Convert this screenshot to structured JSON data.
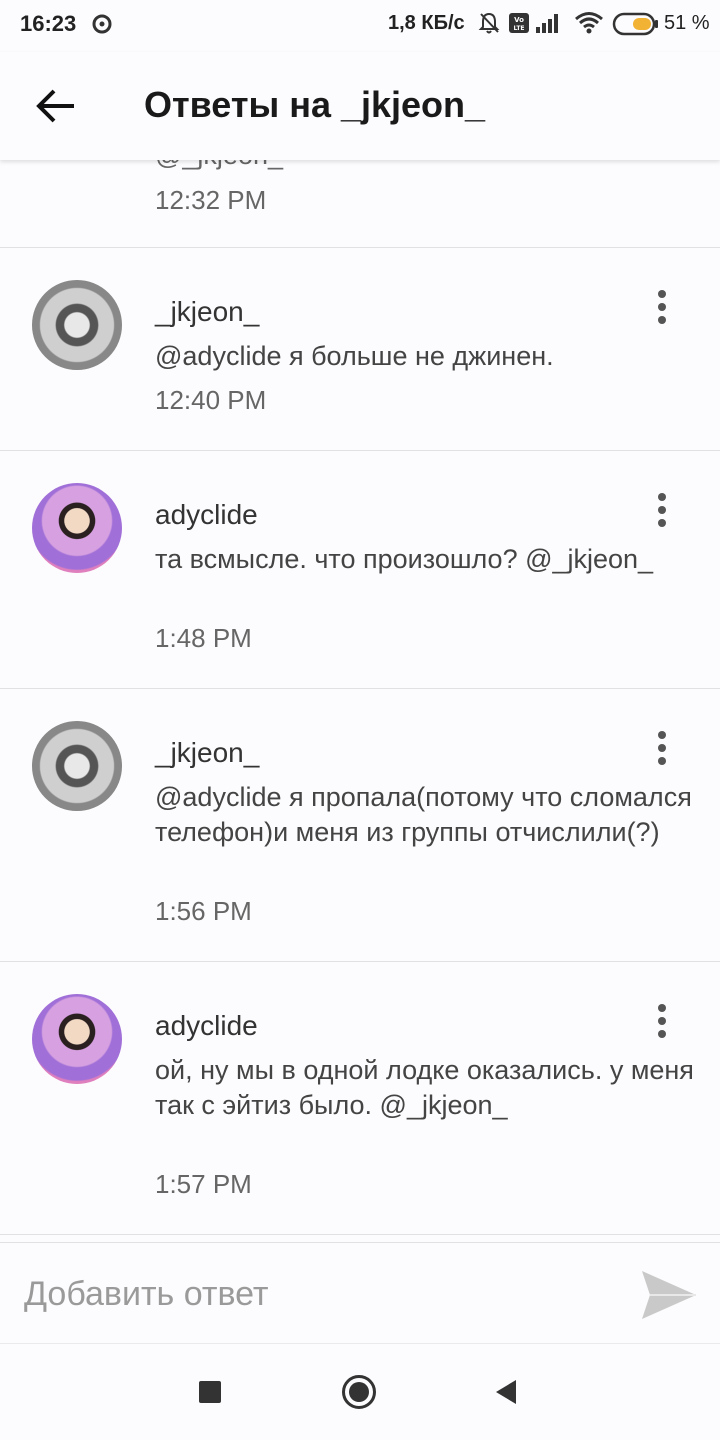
{
  "status_bar": {
    "time": "16:23",
    "network_speed": "1,8 КБ/с",
    "battery_percent": "51 %",
    "icons": [
      "sync-icon",
      "mute-icon",
      "volte-icon",
      "signal-icon",
      "wifi-icon",
      "battery-icon"
    ]
  },
  "app_bar": {
    "title": "Ответы на _jkjeon_",
    "back_icon": "arrow-left-icon"
  },
  "partial_reply": {
    "mention": "@_jkjeon_",
    "time": "12:32 PM"
  },
  "replies": [
    {
      "author": "_jkjeon_",
      "text": "@adyclide  я больше не джинен.",
      "time": "12:40 PM"
    },
    {
      "author": "adyclide",
      "text": "та всмысле. что произошло? @_jkjeon_",
      "time": "1:48 PM"
    },
    {
      "author": "_jkjeon_",
      "text": "@adyclide  я пропала(потому что сломался телефон)и меня из группы отчислили(?)",
      "time": "1:56 PM"
    },
    {
      "author": "adyclide",
      "text": "ой, ну мы в одной лодке оказались. у меня так с эйтиз было. @_jkjeon_",
      "time": "1:57 PM"
    }
  ],
  "composer": {
    "placeholder": "Добавить ответ",
    "value": "",
    "send_icon": "send-icon"
  },
  "nav_bar": {
    "icons": [
      "recents-square-icon",
      "home-circle-icon",
      "back-triangle-icon"
    ]
  },
  "colors": {
    "background": "#fcfbfd",
    "divider": "#e2e0e4",
    "text_primary": "#222222",
    "text_secondary": "#666666",
    "battery_fill": "#f2b233"
  }
}
